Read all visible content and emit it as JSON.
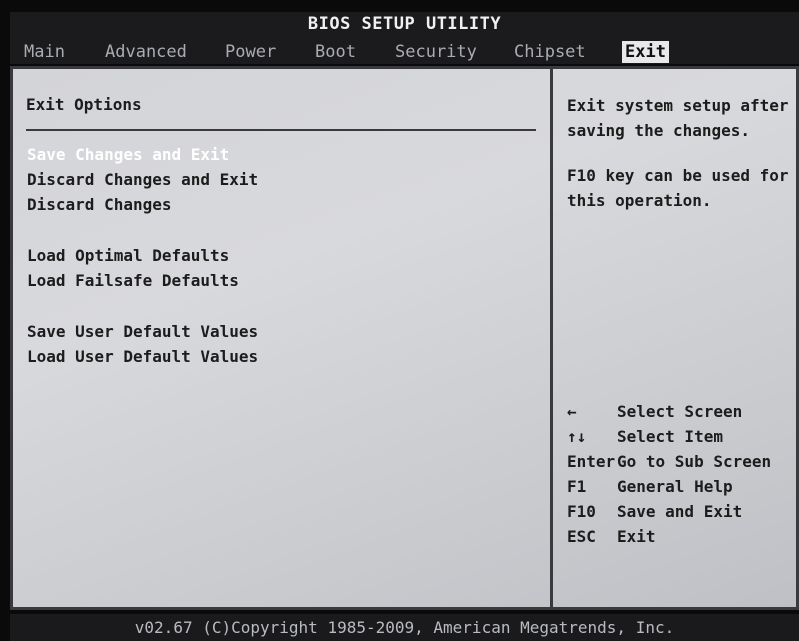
{
  "app_title": "BIOS SETUP UTILITY",
  "tabs": [
    "Main",
    "Advanced",
    "Power",
    "Boot",
    "Security",
    "Chipset",
    "Exit"
  ],
  "active_tab": "Exit",
  "section_title": "Exit Options",
  "options": [
    {
      "label": "Save Changes and Exit",
      "selected": true
    },
    {
      "label": "Discard Changes and Exit",
      "selected": false
    },
    {
      "label": "Discard Changes",
      "selected": false
    },
    {
      "label": "Load Optimal Defaults",
      "selected": false
    },
    {
      "label": "Load Failsafe Defaults",
      "selected": false
    },
    {
      "label": "Save User Default Values",
      "selected": false
    },
    {
      "label": "Load User Default Values",
      "selected": false
    }
  ],
  "help_text": [
    "Exit system setup after saving the changes.",
    "F10 key can be used for this operation."
  ],
  "keys": [
    {
      "key": "←",
      "action": "Select Screen"
    },
    {
      "key": "↑↓",
      "action": "Select Item"
    },
    {
      "key": "Enter",
      "action": "Go to Sub Screen"
    },
    {
      "key": "F1",
      "action": "General Help"
    },
    {
      "key": "F10",
      "action": "Save and Exit"
    },
    {
      "key": "ESC",
      "action": "Exit"
    }
  ],
  "footer": "v02.67 (C)Copyright 1985-2009, American Megatrends, Inc.",
  "colors": {
    "panel_bg": "#d2d3d7",
    "selected_text": "#ffffff",
    "active_tab_bg": "#e8e8ea"
  }
}
